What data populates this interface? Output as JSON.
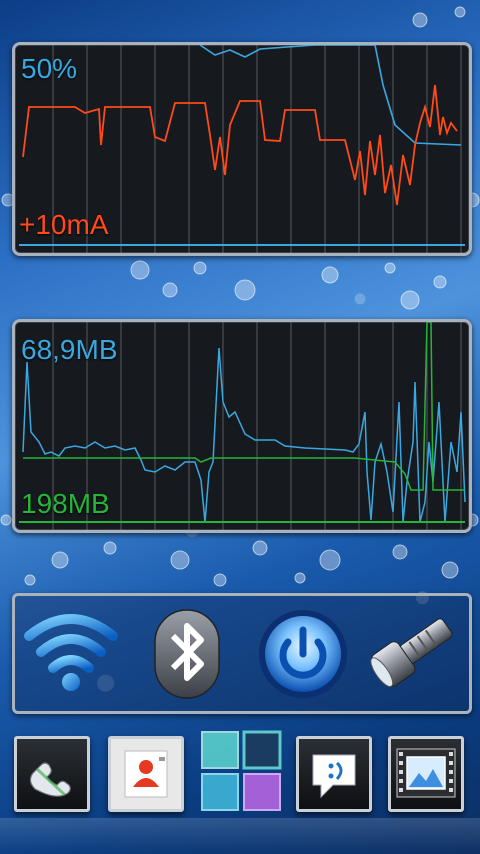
{
  "battery_widget": {
    "percent_label": "50%",
    "current_label": "+10mA",
    "percent_color": "#3aa8e0",
    "current_color": "#ff4a1a"
  },
  "memory_widget": {
    "used_label": "68,9MB",
    "free_label": "198MB",
    "used_color": "#3aa8e0",
    "free_color": "#27b43a"
  },
  "toggles": {
    "items": [
      {
        "name": "wifi-toggle",
        "icon": "wifi-icon"
      },
      {
        "name": "bluetooth-toggle",
        "icon": "bluetooth-icon"
      },
      {
        "name": "power-toggle",
        "icon": "power-icon"
      },
      {
        "name": "flashlight-toggle",
        "icon": "flashlight-icon"
      }
    ]
  },
  "dock": {
    "items": [
      {
        "name": "phone",
        "icon": "phone-icon"
      },
      {
        "name": "contacts",
        "icon": "contacts-icon"
      },
      {
        "name": "app-drawer",
        "icon": "app-grid-icon"
      },
      {
        "name": "messaging",
        "icon": "message-icon"
      },
      {
        "name": "gallery",
        "icon": "gallery-icon"
      }
    ]
  }
}
